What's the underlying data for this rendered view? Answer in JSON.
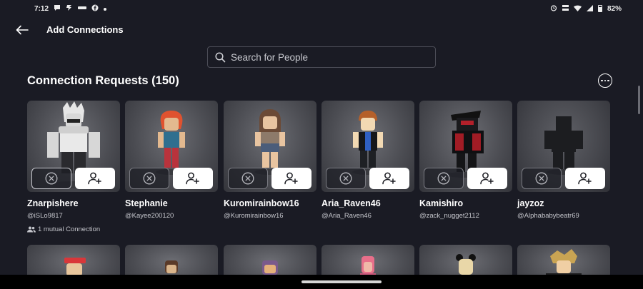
{
  "status_bar": {
    "time": "7:12",
    "battery": "82%",
    "left_icons": [
      "chat-bubble-icon",
      "bolt-icon",
      "tbh-icon",
      "facebook-icon",
      "dot-icon"
    ],
    "right_icons": [
      "alarm-icon",
      "lte-icon",
      "wifi-icon",
      "signal-icon",
      "battery-icon"
    ]
  },
  "header": {
    "title": "Add Connections",
    "back_icon": "arrow-left-icon"
  },
  "search": {
    "placeholder": "Search for People"
  },
  "section": {
    "title": "Connection Requests (150)"
  },
  "requests": [
    {
      "name": "Znarpishere",
      "handle": "@iSLo9817",
      "mutual": "1 mutual Connection"
    },
    {
      "name": "Stephanie",
      "handle": "@Kayee200120"
    },
    {
      "name": "Kuromirainbow16",
      "handle": "@Kuromirainbow16"
    },
    {
      "name": "Aria_Raven46",
      "handle": "@Aria_Raven46"
    },
    {
      "name": "Kamishiro",
      "handle": "@zack_nugget2112"
    },
    {
      "name": "jayzoz",
      "handle": "@Alphababybeatr69"
    }
  ],
  "colors": {
    "background": "#1a1b24",
    "card": "#4c4d53",
    "accept_button": "#ffffff",
    "text_secondary": "#c4c5cb"
  }
}
